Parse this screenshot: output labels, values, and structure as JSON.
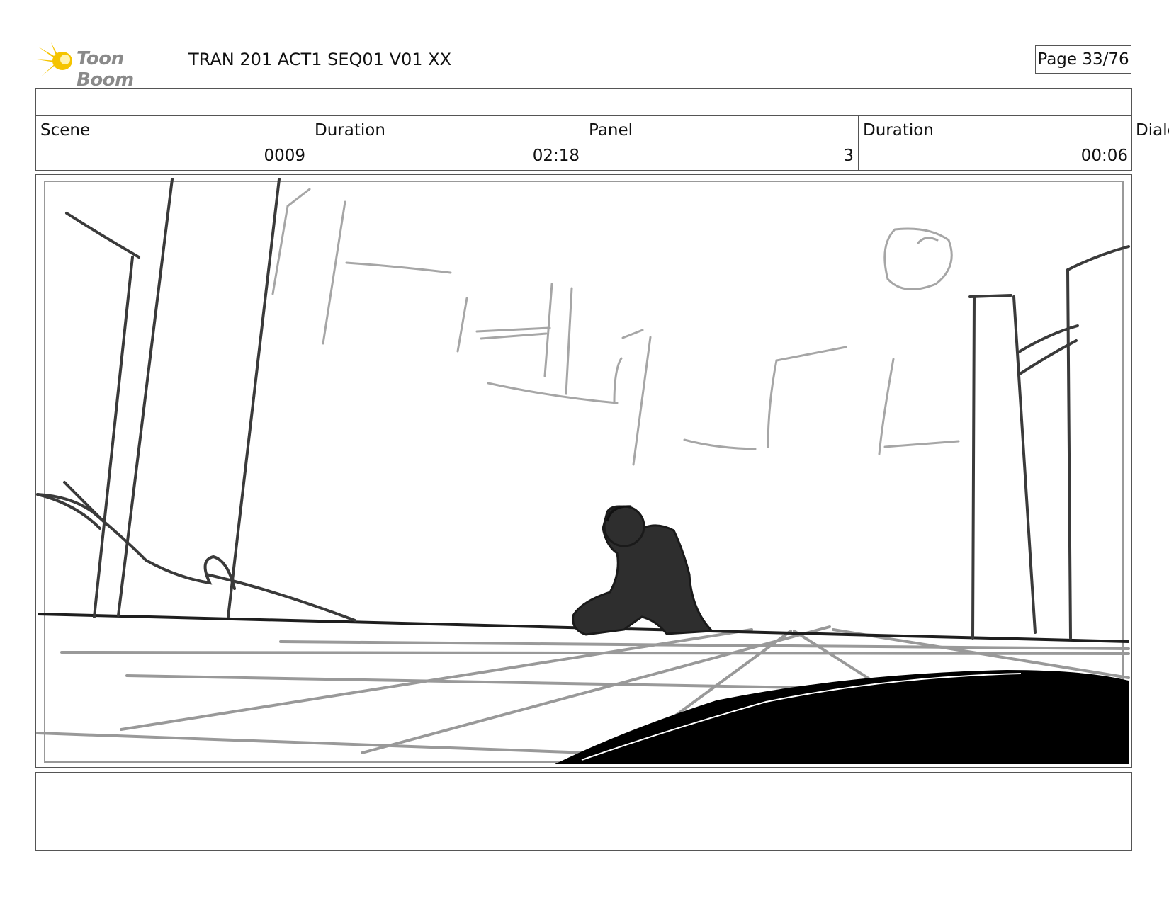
{
  "header": {
    "brand": "Toon Boom",
    "title": "TRAN 201 ACT1 SEQ01 V01 XX",
    "page": "Page 33/76"
  },
  "info": {
    "scene_label": "Scene",
    "scene_value": "0009",
    "duration_label": "Duration",
    "duration_value": "02:18",
    "panel_label": "Panel",
    "panel_value": "3",
    "panel_duration_label": "Duration",
    "panel_duration_value": "00:06",
    "dialog_label": "Dialo"
  },
  "panel": {
    "sketch": "storyboard-sketch"
  },
  "colors": {
    "logo_yellow": "#f5c400",
    "logo_text": "#8a8a8a",
    "border": "#555555",
    "ink": "#2e2e2e"
  }
}
